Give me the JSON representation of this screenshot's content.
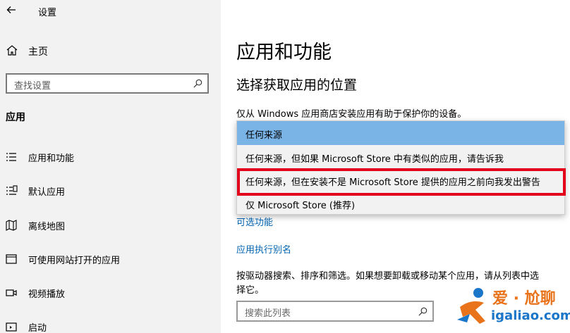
{
  "window": {
    "title": "设置"
  },
  "sidebar": {
    "home_label": "主页",
    "search_placeholder": "查找设置",
    "section_label": "应用",
    "items": [
      {
        "label": "应用和功能",
        "icon": "list-icon"
      },
      {
        "label": "默认应用",
        "icon": "default-apps-icon"
      },
      {
        "label": "离线地图",
        "icon": "map-icon"
      },
      {
        "label": "可使用网站打开的应用",
        "icon": "web-apps-icon"
      },
      {
        "label": "视频播放",
        "icon": "video-icon"
      },
      {
        "label": "启动",
        "icon": "startup-icon"
      }
    ]
  },
  "main": {
    "title": "应用和功能",
    "subtitle": "选择获取应用的位置",
    "description": "仅从 Windows 应用商店安装应用有助于保护你的设备。",
    "dropdown": {
      "options": [
        "任何来源",
        "任何来源，但如果 Microsoft Store 中有类似的应用，请告诉我",
        "任何来源，但在安装不是 Microsoft Store 提供的应用之前向我发出警告",
        "仅 Microsoft Store (推荐)"
      ],
      "selected_index": 0,
      "highlighted_index": 2
    },
    "links": {
      "optional_features": "可选功能",
      "app_alias": "应用执行别名"
    },
    "info_text": "按驱动器搜索、排序和筛选。如果想要卸载或移动某个应用，请从列表中选择它。",
    "list_search_placeholder": "搜索此列表"
  },
  "watermark": {
    "line1": "爱 · 尬聊",
    "line2": "igaliao.com"
  },
  "colors": {
    "sidebar_bg": "#f2f2f2",
    "selected_option": "#7ab3e6",
    "link": "#0063b1",
    "highlight_box": "#e3001b"
  }
}
